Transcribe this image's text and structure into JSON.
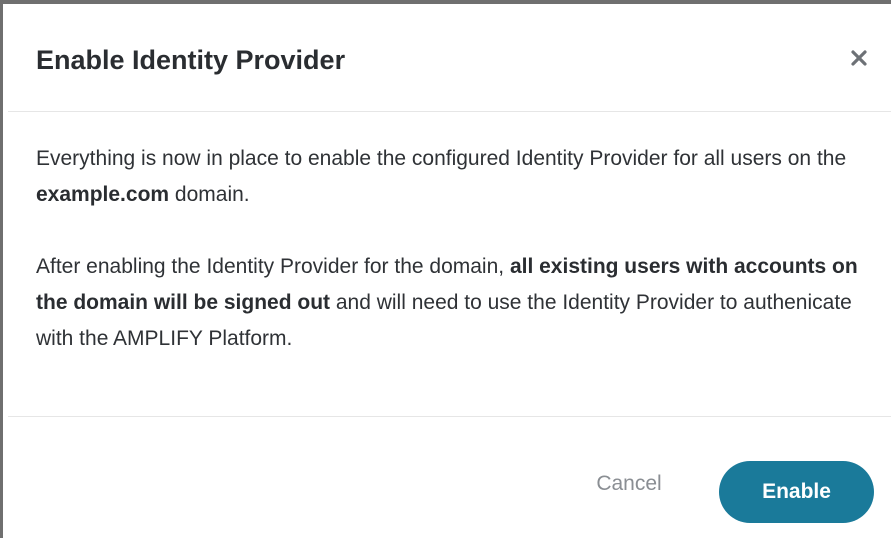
{
  "dialog": {
    "title": "Enable Identity Provider",
    "close_icon": "close-icon",
    "paragraph1": {
      "before": "Everything is now in place to enable the configured Identity Provider for all users on the ",
      "bold": "example.com",
      "after": " domain."
    },
    "paragraph2": {
      "before": "After enabling the Identity Provider for the domain, ",
      "bold": "all existing users with accounts on the domain will be signed out",
      "after": " and will need to use the Identity Provider to authenicate with the AMPLIFY Platform."
    },
    "buttons": {
      "cancel_label": "Cancel",
      "enable_label": "Enable"
    }
  },
  "colors": {
    "primary": "#1a7a9a",
    "title_text": "#2a2d31",
    "body_text": "#2f3236",
    "muted_text": "#8a8e93",
    "divider": "#e6e6e6"
  }
}
